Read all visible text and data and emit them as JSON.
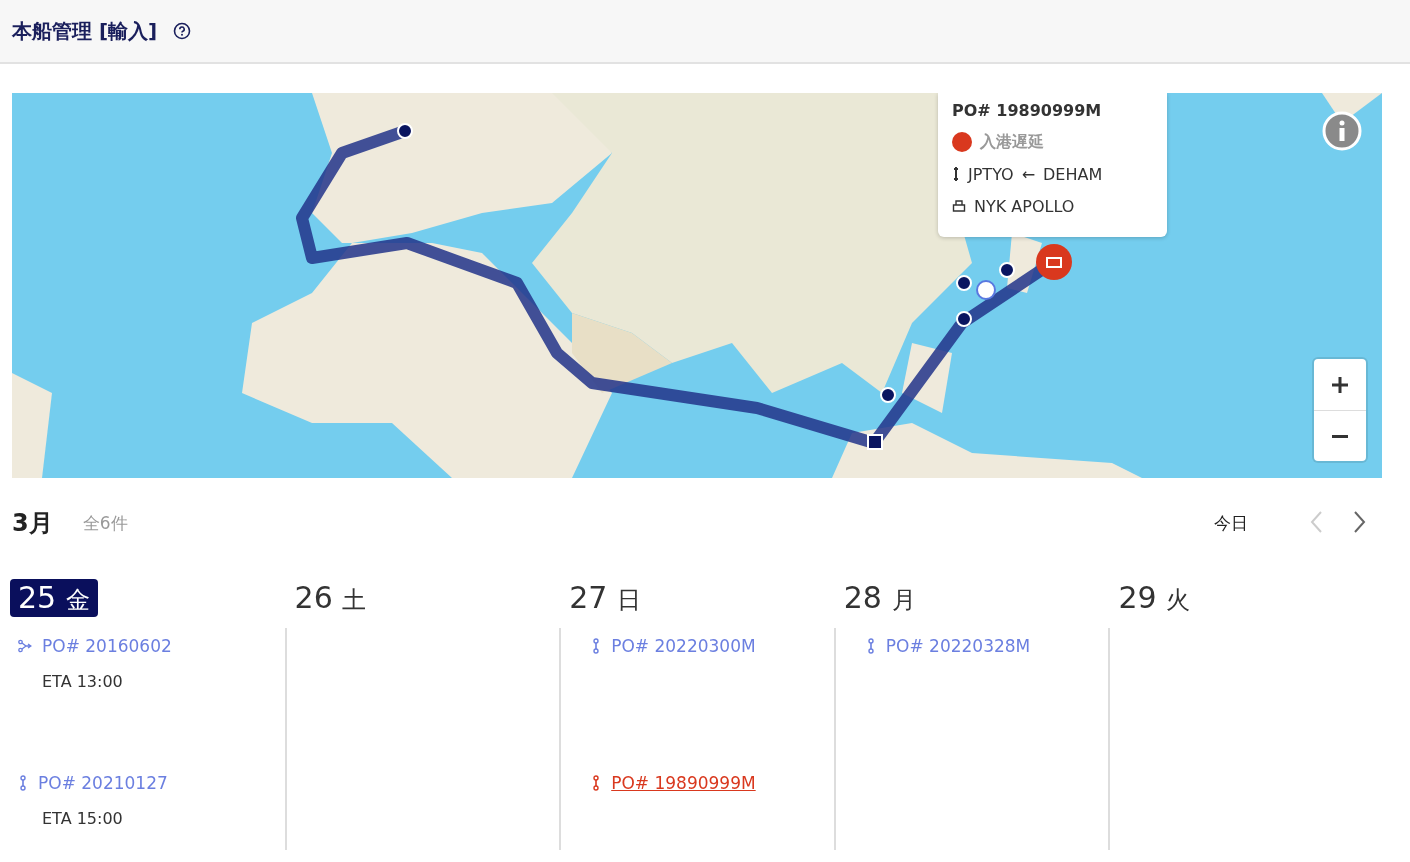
{
  "header": {
    "title": "本船管理 [輸入]"
  },
  "map": {
    "popup": {
      "po": "PO# 19890999M",
      "status": {
        "label": "入港遅延",
        "color": "#d9381e"
      },
      "route": {
        "to": "JPTYO",
        "arrow": "←",
        "from": "DEHAM"
      },
      "vessel": "NYK APOLLO"
    }
  },
  "calendar": {
    "month": "3月",
    "count": "全6件",
    "today_button": "今日",
    "prev": {
      "disabled": true
    },
    "next": {
      "disabled": false
    },
    "days": [
      {
        "date": "25",
        "weekday": "金",
        "selected": true,
        "events": [
          {
            "kind": "transship",
            "po": "PO# 20160602",
            "eta": "ETA 13:00",
            "delayed": false
          },
          {
            "kind": "direct",
            "po": "PO# 20210127",
            "eta": "ETA 15:00",
            "delayed": false
          }
        ]
      },
      {
        "date": "26",
        "weekday": "土",
        "selected": false
      },
      {
        "date": "27",
        "weekday": "日",
        "selected": false,
        "events": [
          {
            "kind": "direct",
            "po": "PO# 20220300M",
            "delayed": false
          },
          {
            "kind": "direct",
            "po": "PO# 19890999M",
            "delayed": true
          }
        ]
      },
      {
        "date": "28",
        "weekday": "月",
        "selected": false,
        "events": [
          {
            "kind": "direct",
            "po": "PO# 20220328M",
            "delayed": false
          }
        ]
      },
      {
        "date": "29",
        "weekday": "火",
        "selected": false
      }
    ]
  }
}
